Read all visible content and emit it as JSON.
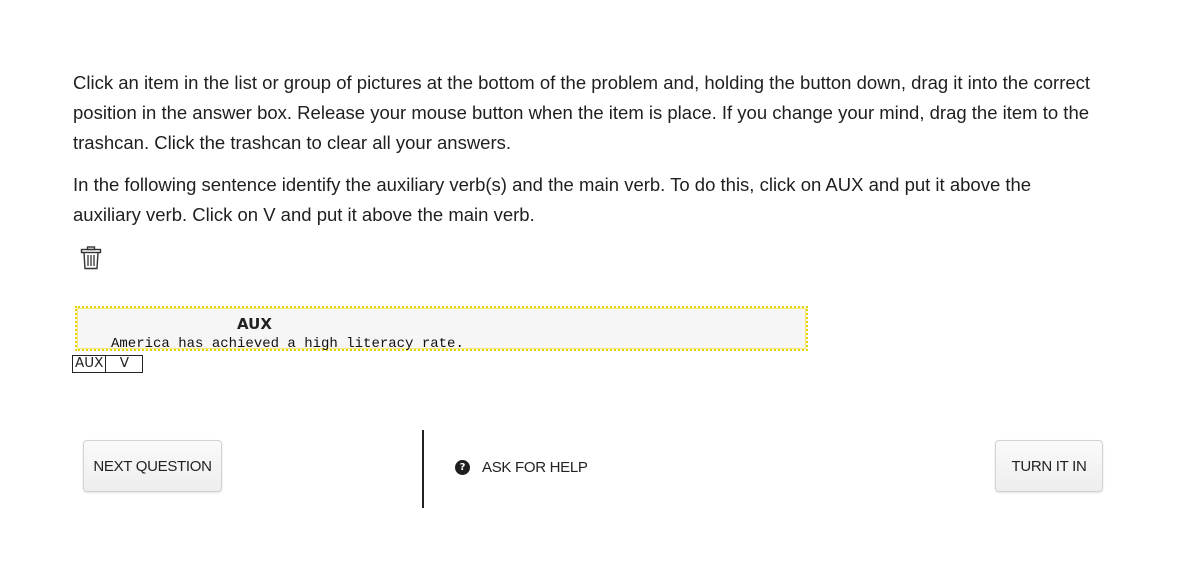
{
  "instructions": {
    "paragraph1": "Click an item in the list or group of pictures at the bottom of the problem and, holding the button down, drag it into the correct position in the answer box. Release your mouse button when the item is place. If you change your mind, drag the item to the trashcan. Click the trashcan to clear all your answers.",
    "paragraph2": "In the following sentence identify the auxiliary verb(s) and the main verb. To do this, click on AUX and put it above the auxiliary verb. Click on V and put it above the main verb."
  },
  "trash": {
    "icon": "trash-icon"
  },
  "answer_box": {
    "placed_label": "AUX",
    "sentence": "America has achieved a high literacy rate."
  },
  "tokens": {
    "aux": "AUX",
    "v": "V"
  },
  "footer": {
    "next_label": "NEXT QUESTION",
    "help_label": "ASK FOR HELP",
    "help_icon_glyph": "?",
    "turn_in_label": "TURN IT IN"
  },
  "colors": {
    "answer_box_border": "#e6d400",
    "answer_box_background": "#f6f6f6"
  }
}
